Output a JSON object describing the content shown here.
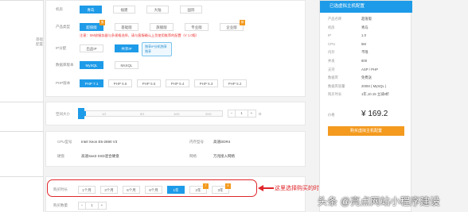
{
  "region": {
    "label": "机房",
    "options": [
      "青岛",
      "福建",
      "大陆",
      "国际"
    ]
  },
  "product": {
    "label": "产品类型",
    "options": [
      "超值版",
      "基础版",
      "旗舰版",
      "专业版",
      "企业版"
    ],
    "warning": "注意：SM放服务器与多规格选择，请与客服确认上货使用推荐的配置（V 1.0版）"
  },
  "ip": {
    "label": "IP分配",
    "options": [
      "出品IP",
      "共享IP"
    ],
    "tip_lines": [
      "独享IP分机独享",
      "独享"
    ]
  },
  "database": {
    "label": "数据库版本",
    "options": [
      "MySQL",
      "MsSQL"
    ]
  },
  "php": {
    "label": "PHP版本",
    "options": [
      "PHP 7.1",
      "PHP 5.6",
      "PHP 5.5",
      "PHP 5.4",
      "PHP 5.3",
      "PHP 5.2"
    ]
  },
  "space": {
    "label": "空间大小",
    "ticks": [
      "1G",
      "5G",
      "10G",
      "20G"
    ],
    "value": "1",
    "unit": "G",
    "fill_fraction": 0.04
  },
  "hardware": {
    "cpu_label": "CPU型号",
    "cpu": "Intel Xeon E5-2690 V3",
    "mem_label": "内存型号",
    "mem": "高速DDR4",
    "disk_label": "硬盘",
    "disk": "高速Sas3 SSD混合硬盘",
    "net_label": "网络",
    "net": "万兆接入网络"
  },
  "duration": {
    "label": "购买时长",
    "options": [
      "1个月",
      "3个月",
      "6个月",
      "9个月",
      "1年",
      "2年",
      "3年"
    ],
    "badges": [
      "7",
      "8"
    ],
    "annotation": "这里选择购买的时间"
  },
  "quantity": {
    "label": "购买数量",
    "value": "1"
  },
  "summary": {
    "header": "已选虚拟主机配置",
    "rows": [
      {
        "label": "产品名称",
        "value": "超值版"
      },
      {
        "label": "机房",
        "value": "青岛"
      },
      {
        "label": "IP",
        "value": "1.0"
      },
      {
        "label": "CPU",
        "value": "5M"
      },
      {
        "label": "内存",
        "value": "不限"
      },
      {
        "label": "并发",
        "value": "800"
      },
      {
        "label": "支持",
        "value": "ASP / PHP"
      },
      {
        "label": "数据库",
        "value": "免费送"
      },
      {
        "label": "数据库容量",
        "value": "200M ( MySQL )"
      },
      {
        "label": "购买时长",
        "value": "1年,10.15 立减8折"
      }
    ],
    "price_label": "价格",
    "price": "¥ 169.2",
    "buy_label": "购买虚拟主机配置"
  },
  "watermark": "头条 @亮点网站小程序建设",
  "colors": {
    "accent": "#1e9be8",
    "buy": "#f39a1f",
    "annotation": "#e0262b"
  }
}
